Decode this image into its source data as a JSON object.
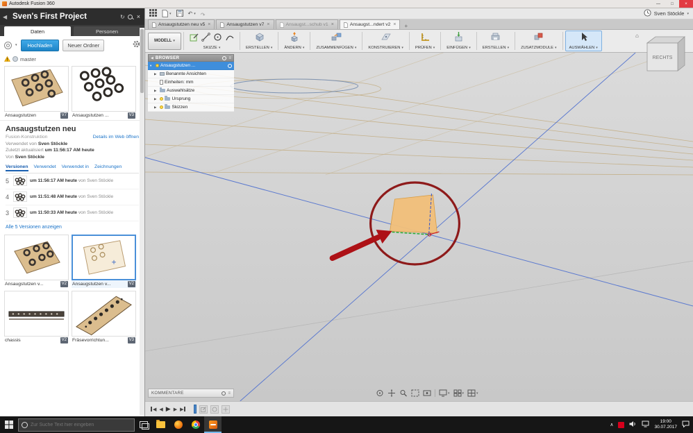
{
  "os": {
    "titlebar": {
      "title": "Autodesk Fusion 360"
    },
    "taskbar": {
      "search_placeholder": "Zur Suche Text hier eingeben",
      "time": "19:00",
      "date": "30.07.2017"
    }
  },
  "icons": {
    "caret_down": "▾",
    "expand": "▶",
    "expanded": "▾",
    "close": "×",
    "back": "◀",
    "prev": "◀",
    "play": "▶",
    "next": "▶",
    "home": "⌂",
    "grip": "≡",
    "chevron_up": "∧",
    "minimize": "—",
    "maximize": "□",
    "undo": "↶",
    "redo": "↷",
    "refresh": "↻",
    "plus": "+"
  },
  "data_panel": {
    "title": "Sven's First Project",
    "tabs": [
      {
        "label": "Daten"
      },
      {
        "label": "Personen"
      }
    ],
    "actions": {
      "upload": "Hochladen",
      "new_folder": "Neuer Ordner"
    },
    "breadcrumb": "master",
    "cards_top": [
      {
        "label": "Ansaugstutzen",
        "version": "V7"
      },
      {
        "label": "Ansaugstutzen ...",
        "version": "V3"
      }
    ],
    "detail": {
      "title": "Ansaugstutzen neu",
      "type": "Fusion-Konstruktion",
      "web_link": "Details im Web öffnen",
      "used_by_prefix": "Verwendet von",
      "used_by": "Sven Stöckle",
      "updated_prefix": "Zuletzt aktualisiert",
      "updated": "um 11:56:17 AM heute",
      "author_prefix": "Von",
      "author": "Sven Stöckle",
      "tabs": [
        {
          "label": "Versionen"
        },
        {
          "label": "Verwendet"
        },
        {
          "label": "Verwendet in"
        },
        {
          "label": "Zeichnungen"
        }
      ],
      "versions": [
        {
          "num": "5",
          "time": "um 11:56:17 AM heute",
          "by": "von Sven Stöckle"
        },
        {
          "num": "4",
          "time": "um 11:51:48 AM heute",
          "by": "von Sven Stöckle"
        },
        {
          "num": "3",
          "time": "um 11:50:33 AM heute",
          "by": "von Sven Stöckle"
        }
      ],
      "show_all": "Alle 5 Versionen anzeigen"
    },
    "cards_mid": [
      {
        "label": "Ansaugstutzen v...",
        "version": "V2"
      },
      {
        "label": "Ansaugstutzen v...",
        "version": "V2"
      }
    ],
    "cards_bottom": [
      {
        "label": "chassis",
        "version": "V2"
      },
      {
        "label": "Fräsevorrichtun...",
        "version": "V3"
      }
    ]
  },
  "fusion": {
    "user": "Sven Stöckle",
    "doc_tabs": [
      {
        "label": "Ansaugstutzen neu v5"
      },
      {
        "label": "Ansaugstutzen v7"
      },
      {
        "label": "Ansaugst...schub v1"
      },
      {
        "label": "Ansaugst...ndert v2"
      }
    ],
    "toolbar": {
      "workspace": "MODELL",
      "groups": [
        "SKIZZE",
        "ERSTELLEN",
        "ÄNDERN",
        "ZUSAMMENFÜGEN",
        "KONSTRUIEREN",
        "PRÜFEN",
        "EINFÜGEN",
        "ERSTELLEN",
        "ZUSATZMODULE",
        "AUSWÄHLEN"
      ]
    },
    "browser": {
      "header": "BROWSER",
      "items": [
        {
          "label": "Ansaugstutzen ..."
        },
        {
          "label": "Benannte Ansichten"
        },
        {
          "label": "Einheiten: mm"
        },
        {
          "label": "Auswahlsätze"
        },
        {
          "label": "Ursprung"
        },
        {
          "label": "Skizzen"
        }
      ]
    },
    "viewcube_face": "RECHTS",
    "comments_label": "KOMMENTARE"
  }
}
